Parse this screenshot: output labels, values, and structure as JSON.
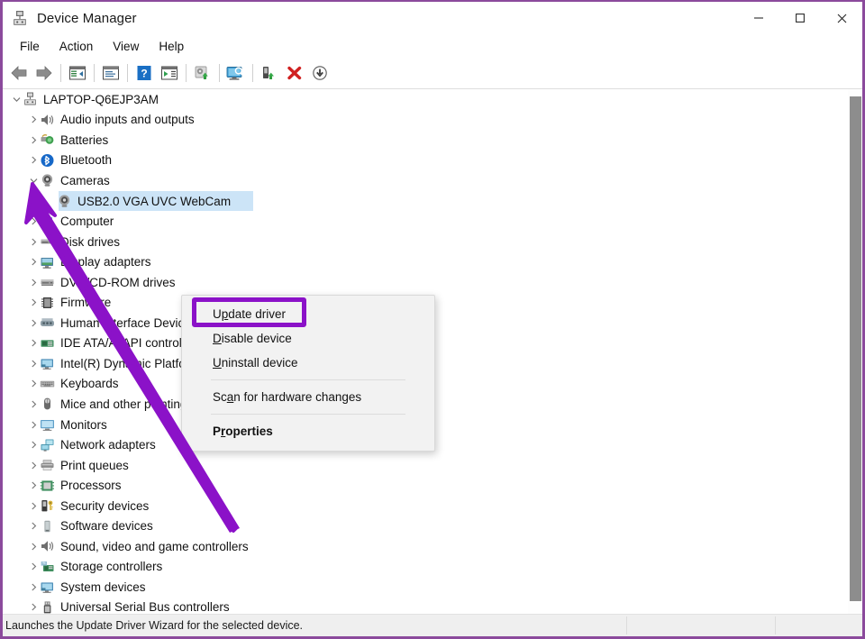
{
  "window": {
    "title": "Device Manager",
    "icon": "device-manager-icon",
    "accent_color": "#8b4a9c",
    "controls": {
      "minimize": "—",
      "maximize": "□",
      "close": "✕"
    }
  },
  "menubar": {
    "items": [
      {
        "label": "File"
      },
      {
        "label": "Action"
      },
      {
        "label": "View"
      },
      {
        "label": "Help"
      }
    ]
  },
  "toolbar": {
    "buttons": [
      {
        "name": "back-icon",
        "tooltip": "Back"
      },
      {
        "name": "forward-icon",
        "tooltip": "Forward"
      },
      {
        "name": "show-hide-console-tree-icon",
        "tooltip": "Show/Hide Console Tree"
      },
      {
        "name": "properties-icon",
        "tooltip": "Properties"
      },
      {
        "name": "help-icon",
        "tooltip": "Help"
      },
      {
        "name": "show-hide-action-pane-icon",
        "tooltip": "Show/Hide Action Pane"
      },
      {
        "name": "update-driver-icon",
        "tooltip": "Update Driver Software"
      },
      {
        "name": "scan-for-hardware-changes-icon",
        "tooltip": "Scan for hardware changes"
      },
      {
        "name": "enable-device-icon",
        "tooltip": "Enable device"
      },
      {
        "name": "uninstall-device-icon",
        "tooltip": "Uninstall device"
      },
      {
        "name": "disable-device-icon",
        "tooltip": "Disable device"
      }
    ]
  },
  "tree": {
    "root": {
      "label": "LAPTOP-Q6EJP3AM",
      "icon": "computer-icon",
      "expanded": true,
      "indent": 0
    },
    "items": [
      {
        "label": "Audio inputs and outputs",
        "icon": "speaker-icon",
        "indent": 1,
        "expanded": false
      },
      {
        "label": "Batteries",
        "icon": "battery-icon",
        "indent": 1,
        "expanded": false
      },
      {
        "label": "Bluetooth",
        "icon": "bluetooth-icon",
        "indent": 1,
        "expanded": false
      },
      {
        "label": "Cameras",
        "icon": "camera-icon",
        "indent": 1,
        "expanded": true
      },
      {
        "label": "USB2.0 VGA UVC WebCam",
        "icon": "camera-icon",
        "indent": 2,
        "expanded": null,
        "selected": true
      },
      {
        "label": "Computer",
        "icon": "computer-icon",
        "indent": 1,
        "expanded": false
      },
      {
        "label": "Disk drives",
        "icon": "disk-drive-icon",
        "indent": 1,
        "expanded": false
      },
      {
        "label": "Display adapters",
        "icon": "display-adapter-icon",
        "indent": 1,
        "expanded": false
      },
      {
        "label": "DVD/CD-ROM drives",
        "icon": "dvd-drive-icon",
        "indent": 1,
        "expanded": false
      },
      {
        "label": "Firmware",
        "icon": "firmware-icon",
        "indent": 1,
        "expanded": false
      },
      {
        "label": "Human Interface Devices",
        "icon": "hid-icon",
        "indent": 1,
        "expanded": false
      },
      {
        "label": "IDE ATA/ATAPI controllers",
        "icon": "ide-controller-icon",
        "indent": 1,
        "expanded": false
      },
      {
        "label": "Intel(R) Dynamic Platform and Thermal Framework",
        "icon": "system-device-icon",
        "indent": 1,
        "expanded": false
      },
      {
        "label": "Keyboards",
        "icon": "keyboard-icon",
        "indent": 1,
        "expanded": false
      },
      {
        "label": "Mice and other pointing devices",
        "icon": "mouse-icon",
        "indent": 1,
        "expanded": false
      },
      {
        "label": "Monitors",
        "icon": "monitor-icon",
        "indent": 1,
        "expanded": false
      },
      {
        "label": "Network adapters",
        "icon": "network-adapter-icon",
        "indent": 1,
        "expanded": false
      },
      {
        "label": "Print queues",
        "icon": "printer-icon",
        "indent": 1,
        "expanded": false
      },
      {
        "label": "Processors",
        "icon": "processor-icon",
        "indent": 1,
        "expanded": false
      },
      {
        "label": "Security devices",
        "icon": "security-device-icon",
        "indent": 1,
        "expanded": false
      },
      {
        "label": "Software devices",
        "icon": "software-device-icon",
        "indent": 1,
        "expanded": false
      },
      {
        "label": "Sound, video and game controllers",
        "icon": "speaker-icon",
        "indent": 1,
        "expanded": false
      },
      {
        "label": "Storage controllers",
        "icon": "storage-controller-icon",
        "indent": 1,
        "expanded": false
      },
      {
        "label": "System devices",
        "icon": "system-device-icon",
        "indent": 1,
        "expanded": false
      },
      {
        "label": "Universal Serial Bus controllers",
        "icon": "usb-controller-icon",
        "indent": 1,
        "expanded": false
      }
    ]
  },
  "context_menu": {
    "items": [
      {
        "label": "Update driver",
        "access_key_index": 2,
        "bold": false,
        "highlighted": true
      },
      {
        "label": "Disable device",
        "access_key_index": 0,
        "bold": false
      },
      {
        "label": "Uninstall device",
        "access_key_index": 0,
        "bold": false
      },
      {
        "separator": true
      },
      {
        "label": "Scan for hardware changes",
        "access_key_index": 3,
        "bold": false
      },
      {
        "separator": true
      },
      {
        "label": "Properties",
        "access_key_index": 1,
        "bold": true
      }
    ]
  },
  "annotation": {
    "type": "arrow",
    "color": "#8b12c8",
    "highlight_color": "#8b12c8",
    "target": "Update driver"
  },
  "statusbar": {
    "text": "Launches the Update Driver Wizard for the selected device."
  }
}
